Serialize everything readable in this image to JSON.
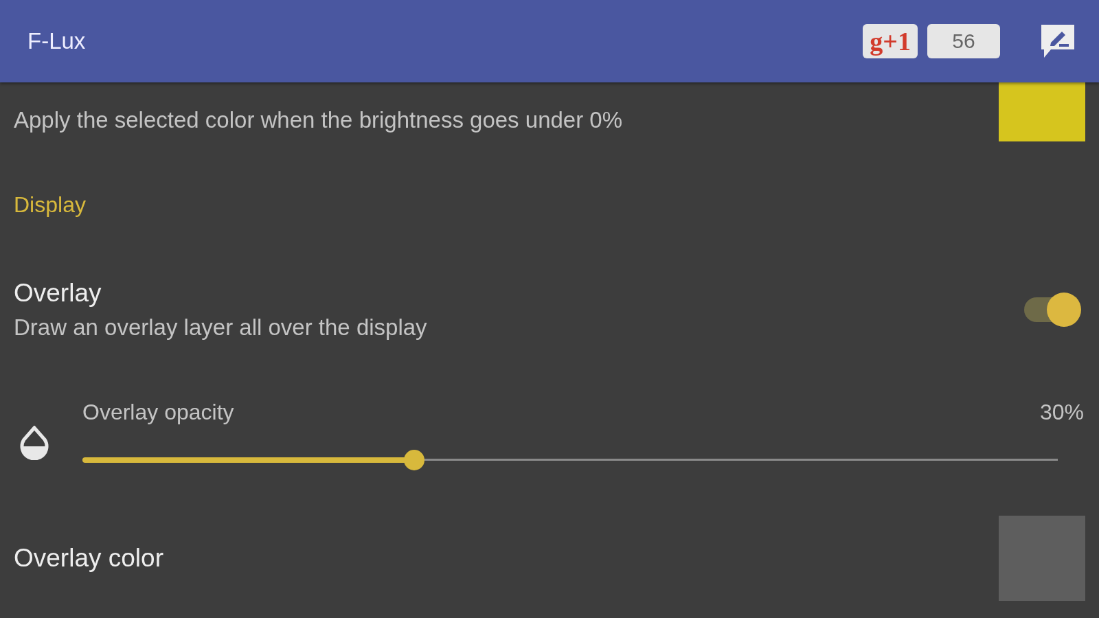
{
  "app_bar": {
    "title": "F-Lux",
    "plus_one": {
      "label": "g+1",
      "count": "56"
    }
  },
  "settings": [
    {
      "kind": "color",
      "summary": "Apply the selected color when the brightness goes under 0%",
      "color": "#d6c51e"
    },
    {
      "kind": "category",
      "title": "Display"
    },
    {
      "kind": "switch",
      "title": "Overlay",
      "summary": "Draw an overlay layer all over the display",
      "on": true
    },
    {
      "kind": "slider",
      "title": "Overlay opacity",
      "reading": "30%",
      "level": 0.34
    },
    {
      "kind": "color",
      "title": "Overlay color",
      "color": "#5e5e5e"
    }
  ]
}
